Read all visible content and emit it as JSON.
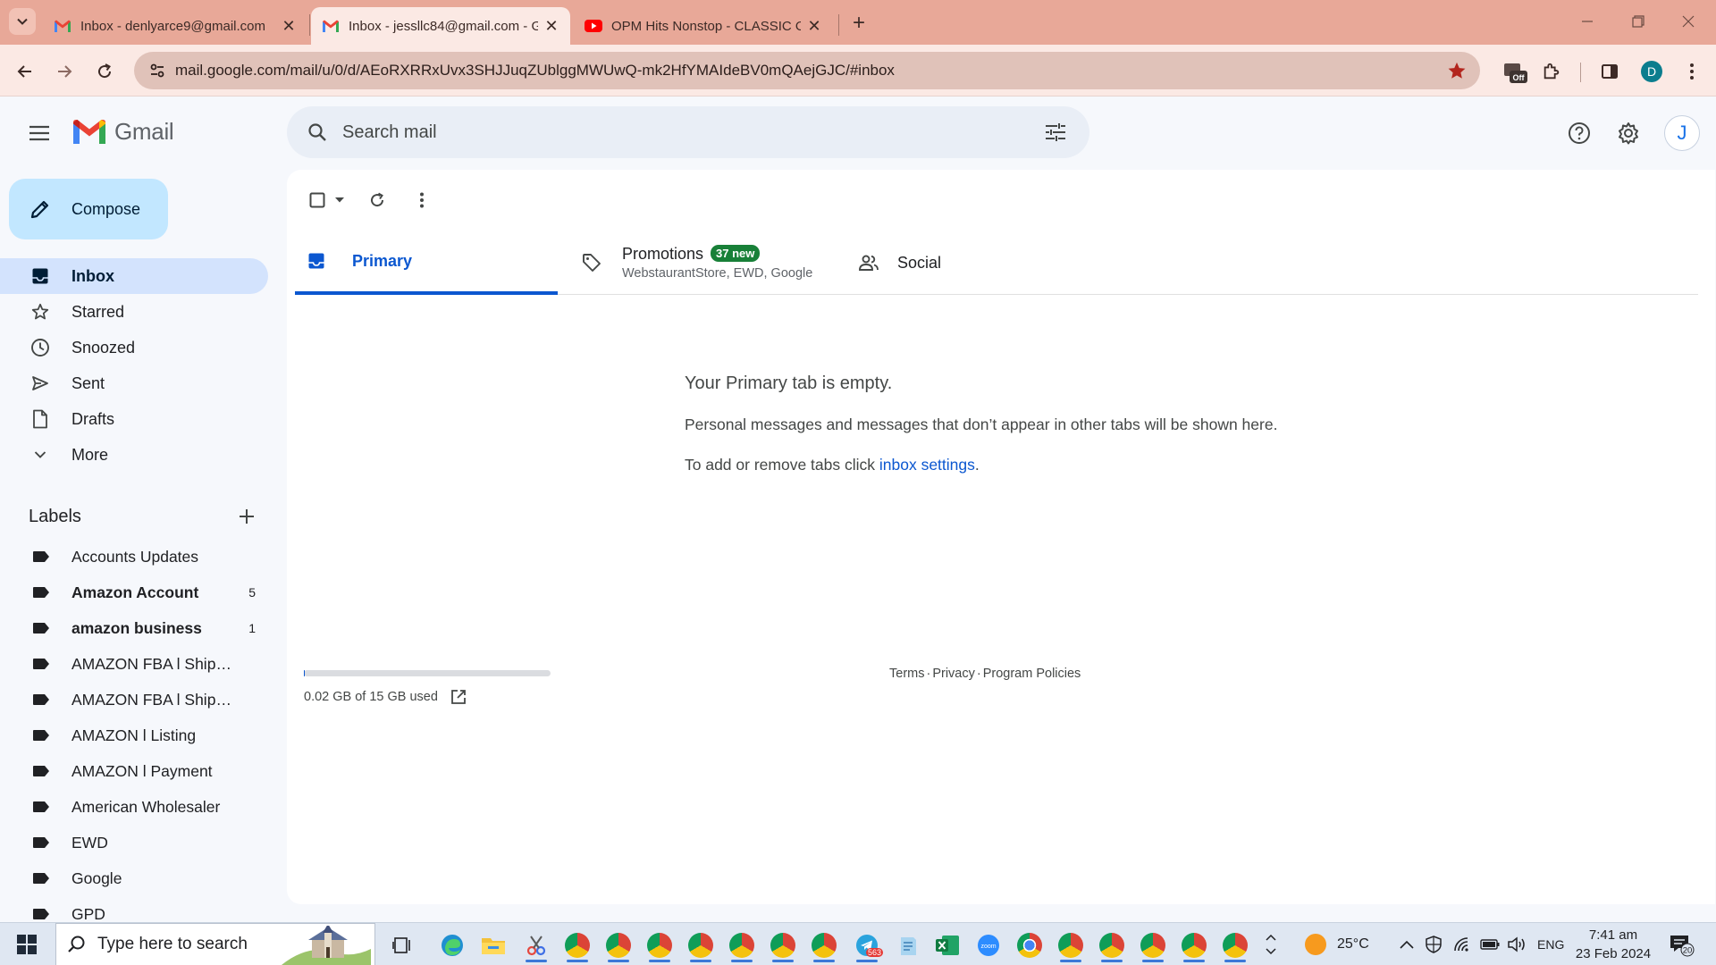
{
  "browser": {
    "tabs": [
      {
        "title": "Inbox - denlyarce9@gmail.com",
        "icon": "gmail-icon",
        "active": false
      },
      {
        "title": "Inbox - jessllc84@gmail.com - G",
        "icon": "gmail-icon",
        "active": true
      },
      {
        "title": "OPM Hits Nonstop - CLASSIC O",
        "icon": "youtube-icon",
        "active": false
      }
    ],
    "url": "mail.google.com/mail/u/0/d/AEoRXRRxUvx3SHJJuqZUblggMWUwQ-mk2HfYMAIdeBV0mQAejGJC/#inbox",
    "extension_badge": "Off",
    "profile_initial": "D",
    "colors": {
      "tabstrip": "#e8a898",
      "toolbar": "#fbe9e4",
      "omnibox": "#e0c2b9",
      "star": "#b3261e"
    }
  },
  "gmail": {
    "wordmark": "Gmail",
    "search_placeholder": "Search mail",
    "account_initial": "J",
    "compose_label": "Compose",
    "nav": [
      {
        "label": "Inbox",
        "icon": "inbox-icon",
        "active": true
      },
      {
        "label": "Starred",
        "icon": "star-icon",
        "active": false
      },
      {
        "label": "Snoozed",
        "icon": "clock-icon",
        "active": false
      },
      {
        "label": "Sent",
        "icon": "send-icon",
        "active": false
      },
      {
        "label": "Drafts",
        "icon": "draft-icon",
        "active": false
      },
      {
        "label": "More",
        "icon": "chevron-down-icon",
        "active": false
      }
    ],
    "labels_title": "Labels",
    "labels": [
      {
        "name": "Accounts Updates",
        "count": "",
        "bold": false
      },
      {
        "name": "Amazon Account",
        "count": "5",
        "bold": true
      },
      {
        "name": "amazon business",
        "count": "1",
        "bold": true
      },
      {
        "name": "AMAZON FBA l Shipment Created",
        "count": "",
        "bold": false
      },
      {
        "name": "AMAZON FBA l Shipped Out",
        "count": "",
        "bold": false
      },
      {
        "name": "AMAZON l Listing",
        "count": "",
        "bold": false
      },
      {
        "name": "AMAZON l Payment",
        "count": "",
        "bold": false
      },
      {
        "name": "American Wholesaler",
        "count": "",
        "bold": false
      },
      {
        "name": "EWD",
        "count": "",
        "bold": false
      },
      {
        "name": "Google",
        "count": "",
        "bold": false
      },
      {
        "name": "GPD",
        "count": "",
        "bold": false
      }
    ],
    "category_tabs": {
      "primary": {
        "label": "Primary"
      },
      "promotions": {
        "label": "Promotions",
        "badge": "37 new",
        "senders": "WebstaurantStore, EWD, Google"
      },
      "social": {
        "label": "Social"
      }
    },
    "empty_state": {
      "title": "Your Primary tab is empty.",
      "description": "Personal messages and messages that don’t appear in other tabs will be shown here.",
      "hint_prefix": "To add or remove tabs click ",
      "hint_link": "inbox settings",
      "hint_suffix": "."
    },
    "storage": {
      "text": "0.02 GB of 15 GB used",
      "fraction": 0.0013
    },
    "footer": {
      "terms": "Terms",
      "privacy": "Privacy",
      "policies": "Program Policies",
      "separator": "·"
    },
    "colors": {
      "accent": "#0b57d0",
      "compose": "#c2e7ff",
      "active_nav": "#d3e3fd",
      "badge": "#188038"
    }
  },
  "taskbar": {
    "search_placeholder": "Type here to search",
    "telegram_badge": "563",
    "weather": "25°C",
    "language": "ENG",
    "time": "7:41 am",
    "date": "23 Feb 2024",
    "notifications": "20"
  }
}
